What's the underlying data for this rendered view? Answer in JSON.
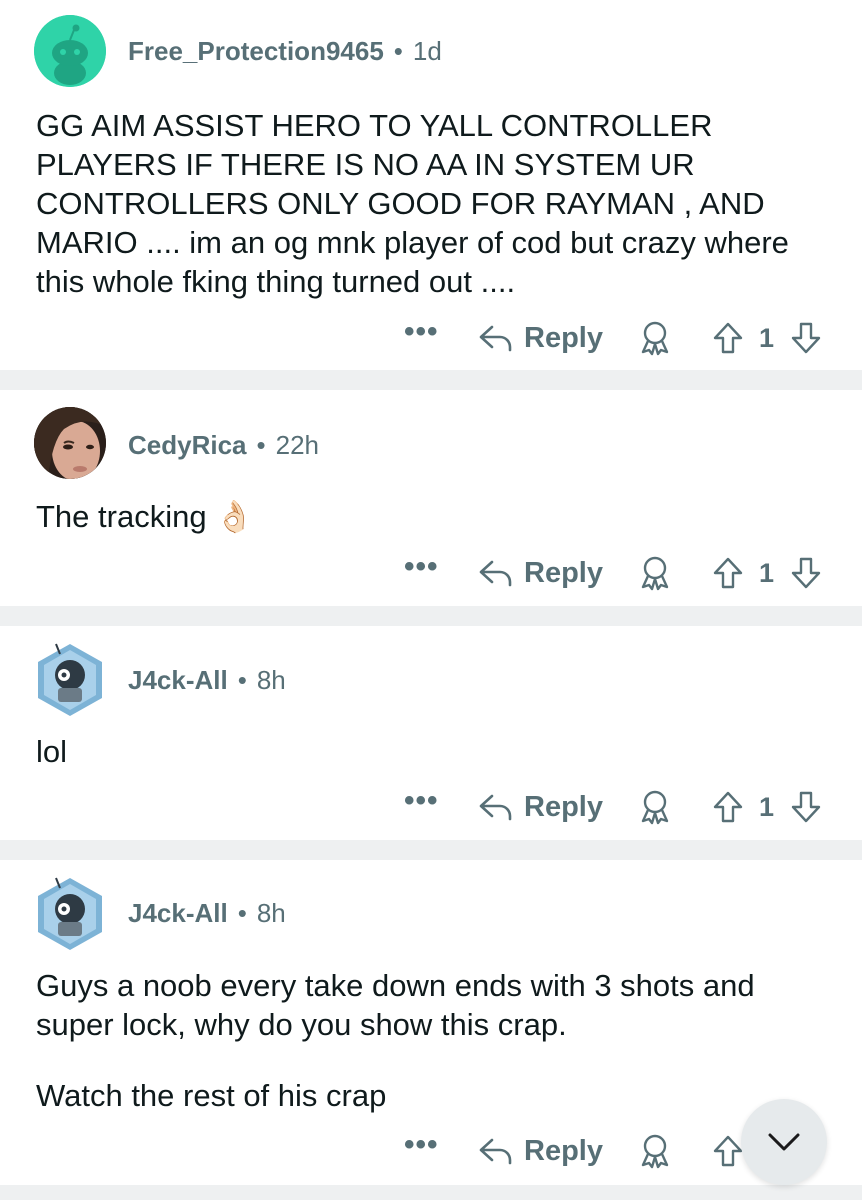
{
  "comments": [
    {
      "username": "Free_Protection9465",
      "separator": "•",
      "age": "1d",
      "avatar": "reddit-snoo-default-avatar",
      "paragraphs": [
        "GG AIM ASSIST HERO TO YALL CONTROLLER PLAYERS IF THERE IS NO AA IN SYSTEM UR CONTROLLERS ONLY GOOD FOR RAYMAN , AND MARIO .... im an og mnk player of cod but crazy where this whole fking thing turned out ...."
      ],
      "more_label": "•••",
      "reply_label": "Reply",
      "vote_count": "1"
    },
    {
      "username": "CedyRica",
      "separator": "•",
      "age": "22h",
      "avatar": "portrait-photo-avatar",
      "paragraphs": [
        "The tracking 👌🏻"
      ],
      "more_label": "•••",
      "reply_label": "Reply",
      "vote_count": "1"
    },
    {
      "username": "J4ck-All",
      "separator": "•",
      "age": "8h",
      "avatar": "hexagon-character-avatar",
      "paragraphs": [
        "lol"
      ],
      "more_label": "•••",
      "reply_label": "Reply",
      "vote_count": "1"
    },
    {
      "username": "J4ck-All",
      "separator": "•",
      "age": "8h",
      "avatar": "hexagon-character-avatar",
      "paragraphs": [
        "Guys a noob every take down ends with 3 shots and super lock, why do you show this crap.",
        "Watch the rest of his crap"
      ],
      "more_label": "•••",
      "reply_label": "Reply",
      "vote_count": ""
    }
  ],
  "icons": {
    "reply": "reply-arrow-icon",
    "award": "award-icon",
    "upvote": "upvote-arrow-icon",
    "downvote": "downvote-arrow-icon",
    "scroll": "chevron-down-icon"
  },
  "colors": {
    "meta_gray": "#576f76",
    "separator_band": "#eef0f1",
    "snoo_teal": "#2fd3a8"
  }
}
